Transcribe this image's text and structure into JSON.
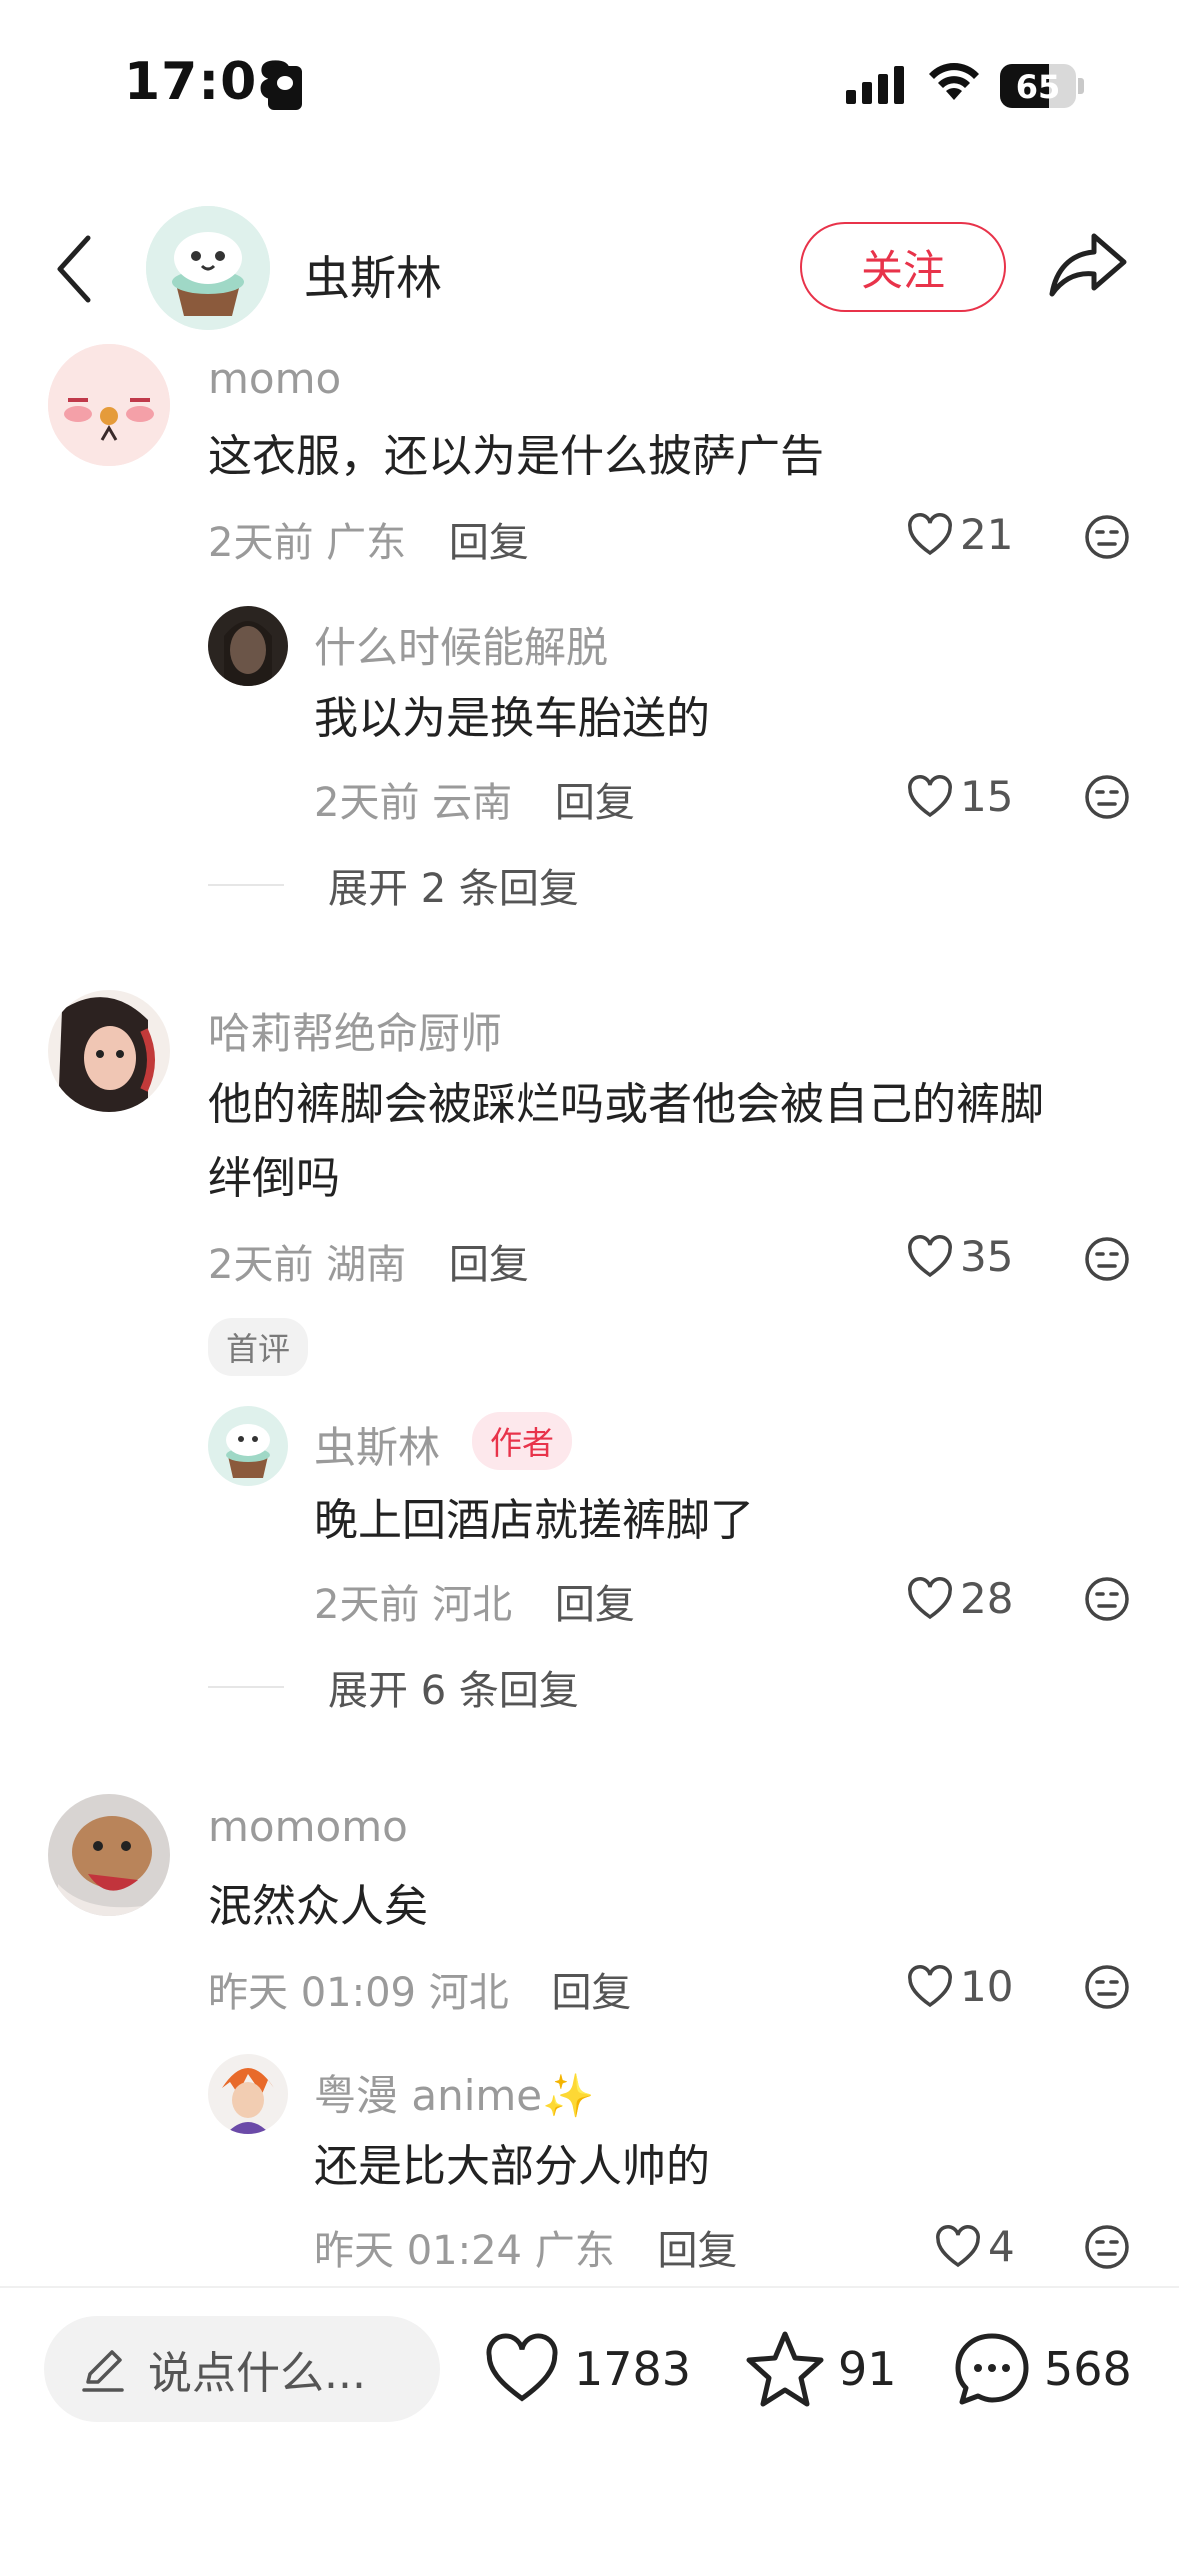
{
  "status_bar": {
    "time": "17:08",
    "battery": "65",
    "battery_level": 0.65
  },
  "header": {
    "title": "虫斯林",
    "follow_label": "关注"
  },
  "comments": [
    {
      "username": "momo",
      "text": "这衣服，还以为是什么披萨广告",
      "time": "2天前",
      "location": "广东",
      "reply_label": "回复",
      "likes": "21",
      "replies": [
        {
          "username": "什么时候能解脱",
          "text": "我以为是换车胎送的",
          "time": "2天前",
          "location": "云南",
          "reply_label": "回复",
          "likes": "15"
        }
      ],
      "expand_label": "展开 2 条回复"
    },
    {
      "username": "哈莉帮绝命厨师",
      "text_line1": "他的裤脚会被踩烂吗或者他会被自己的裤脚",
      "text_line2": "绊倒吗",
      "time": "2天前",
      "location": "湖南",
      "reply_label": "回复",
      "likes": "35",
      "badge": "首评",
      "replies": [
        {
          "username": "虫斯林",
          "author_tag": "作者",
          "text": "晚上回酒店就搓裤脚了",
          "time": "2天前",
          "location": "河北",
          "reply_label": "回复",
          "likes": "28"
        }
      ],
      "expand_label": "展开 6 条回复"
    },
    {
      "username": "momomo",
      "text": "泯然众人矣",
      "time": "昨天 01:09",
      "location": "河北",
      "reply_label": "回复",
      "likes": "10",
      "replies": [
        {
          "username": "粤漫 anime✨",
          "text": "还是比大部分人帅的",
          "time": "昨天 01:24",
          "location": "广东",
          "reply_label": "回复",
          "likes": "4"
        }
      ]
    }
  ],
  "bottom_bar": {
    "input_placeholder": "说点什么...",
    "likes": "1783",
    "favorites": "91",
    "comments": "568"
  },
  "colors": {
    "accent": "#e8334a",
    "muted": "#9a9a9a"
  },
  "icons": [
    "back-icon",
    "share-icon",
    "heart-icon",
    "dislike-face-icon",
    "pencil-icon",
    "star-icon",
    "chat-bubble-icon",
    "signal-icon",
    "wifi-icon",
    "battery-icon"
  ]
}
